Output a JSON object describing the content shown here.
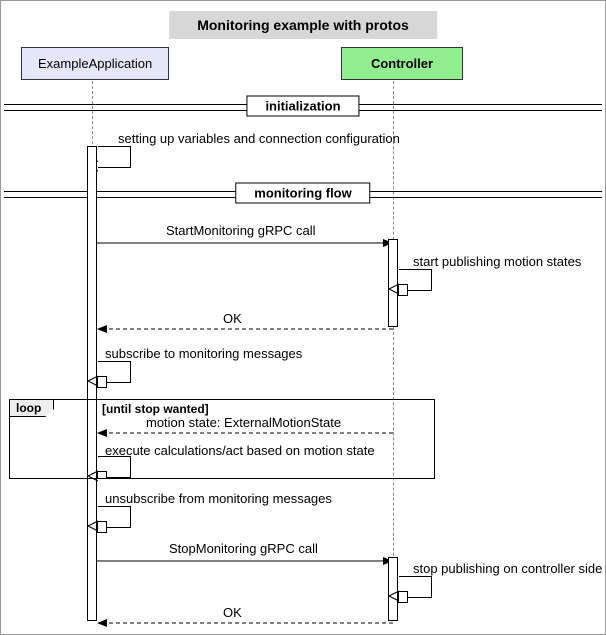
{
  "title": "Monitoring example with protos",
  "participants": {
    "left": "ExampleApplication",
    "right": "Controller"
  },
  "dividers": {
    "init": "initialization",
    "flow": "monitoring flow"
  },
  "messages": {
    "setup": "setting up variables and connection configuration",
    "startCall": "StartMonitoring gRPC call",
    "startPub": "start publishing motion states",
    "ok1": "OK",
    "subscribe": "subscribe to monitoring messages",
    "motionState": "motion state: ExternalMotionState",
    "execute": "execute calculations/act based on motion state",
    "unsubscribe": "unsubscribe from monitoring messages",
    "stopCall": "StopMonitoring gRPC call",
    "stopPub": "stop publishing on controller side",
    "ok2": "OK"
  },
  "loop": {
    "tag": "loop",
    "condition": "[until stop wanted]"
  }
}
